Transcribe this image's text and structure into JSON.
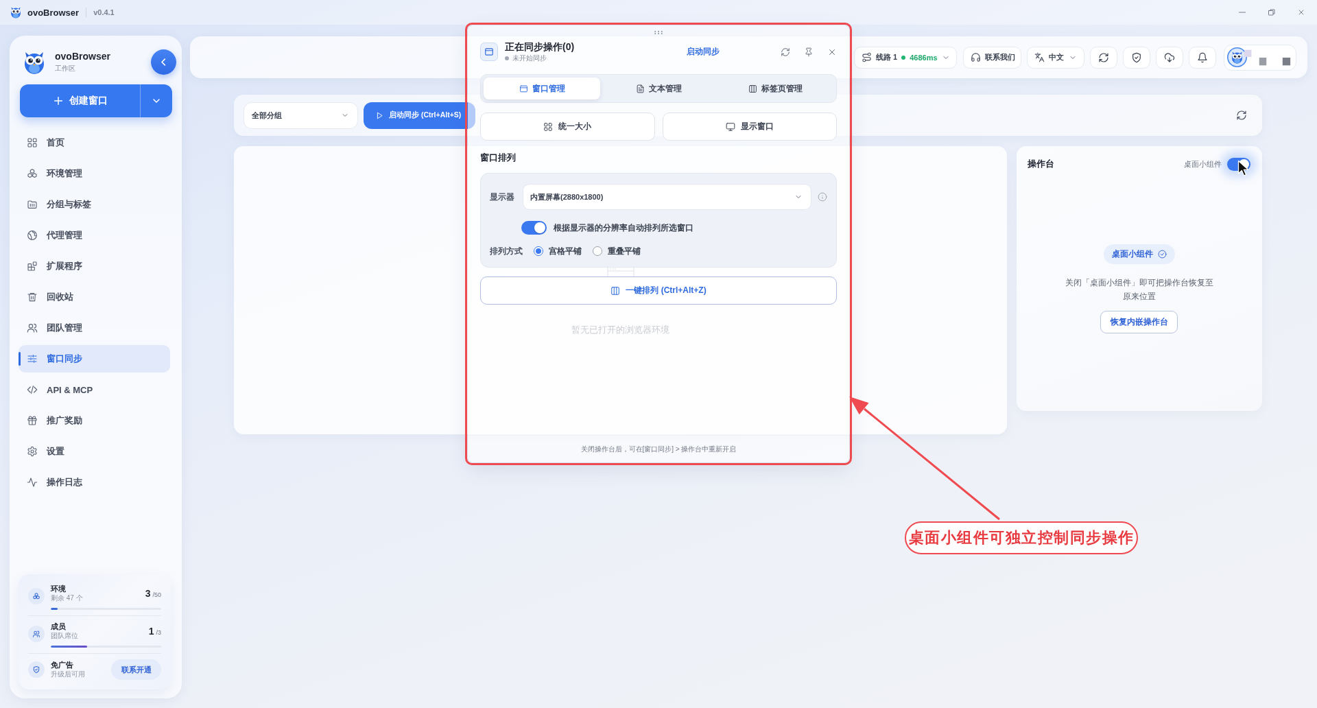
{
  "titlebar": {
    "app_name": "ovoBrowser",
    "version": "v0.4.1"
  },
  "sidebar": {
    "brand": "ovoBrowser",
    "workspace": "工作区",
    "create_button": "创建窗口",
    "nav": [
      {
        "label": "首页",
        "selected": false
      },
      {
        "label": "环境管理",
        "selected": false
      },
      {
        "label": "分组与标签",
        "selected": false
      },
      {
        "label": "代理管理",
        "selected": false
      },
      {
        "label": "扩展程序",
        "selected": false
      },
      {
        "label": "回收站",
        "selected": false
      },
      {
        "label": "团队管理",
        "selected": false
      },
      {
        "label": "窗口同步",
        "selected": true
      },
      {
        "label": "API & MCP",
        "selected": false
      },
      {
        "label": "推广奖励",
        "selected": false
      },
      {
        "label": "设置",
        "selected": false
      },
      {
        "label": "操作日志",
        "selected": false
      }
    ],
    "usage": [
      {
        "title": "环境",
        "subtitle": "剩余 47 个",
        "count": "3",
        "limit": "/50",
        "level": 0.06
      },
      {
        "title": "成员",
        "subtitle": "团队席位",
        "count": "1",
        "limit": "/3",
        "level": 0.33
      }
    ],
    "ad_free": {
      "title": "免广告",
      "subtitle": "升级后可用",
      "button": "联系开通"
    }
  },
  "topbar": {
    "route": {
      "label": "线路 1",
      "latency": "4686ms"
    },
    "contact": "联系我们",
    "language": "中文"
  },
  "toolbar": {
    "group_select": "全部分组",
    "start_button": "启动同步 (Ctrl+Alt+S)"
  },
  "main_panel": {
    "empty_text": "暂无已打开的浏览器环境"
  },
  "console_panel": {
    "title": "操作台",
    "widget_toggle": {
      "label": "桌面小组件",
      "on": true
    },
    "chip": "桌面小组件",
    "description": "关闭「桌面小组件」即可把操作台恢复至原来位置",
    "restore_button": "恢复内嵌操作台"
  },
  "sync_dialog": {
    "title": "正在同步操作(0)",
    "status": "未开始同步",
    "start_link": "启动同步",
    "tabs": [
      {
        "label": "窗口管理",
        "selected": true
      },
      {
        "label": "文本管理",
        "selected": false
      },
      {
        "label": "标签页管理",
        "selected": false
      }
    ],
    "actions": [
      "统一大小",
      "显示窗口"
    ],
    "section_title": "窗口排列",
    "display": {
      "label": "显示器",
      "value": "内置屏幕(2880x1800)"
    },
    "auto_arrange": {
      "label": "根据显示器的分辨率自动排列所选窗口",
      "on": true
    },
    "layout": {
      "label": "排列方式",
      "options": [
        {
          "label": "宫格平铺",
          "selected": true
        },
        {
          "label": "重叠平铺",
          "selected": false
        }
      ]
    },
    "arrange_button": "一键排列 (Ctrl+Alt+Z)",
    "footer": "关闭操作台后，可在[窗口同步] > 操作台中重新开启"
  },
  "annotation": {
    "text": "桌面小组件可独立控制同步操作"
  }
}
